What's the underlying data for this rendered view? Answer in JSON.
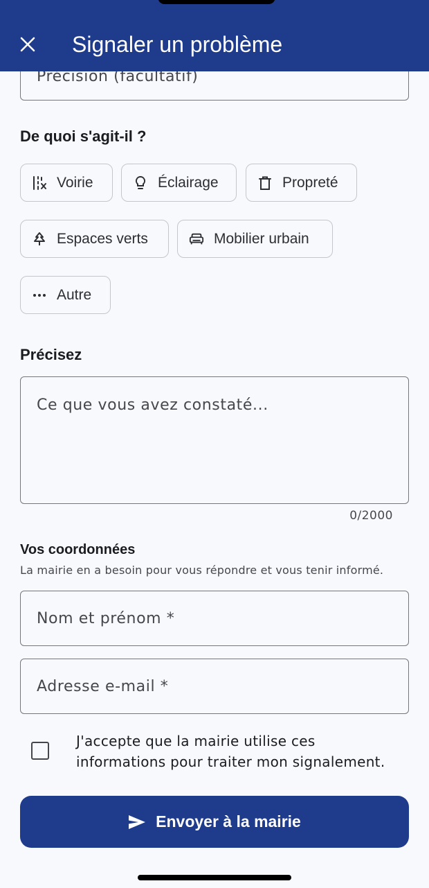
{
  "header": {
    "title": "Signaler un problème",
    "close_icon": "close-icon"
  },
  "precision_field": {
    "placeholder": "Précision (facultatif)"
  },
  "category": {
    "title": "De quoi s'agit-il ?",
    "chips": [
      {
        "label": "Voirie",
        "icon": "road-icon"
      },
      {
        "label": "Éclairage",
        "icon": "lightbulb-icon"
      },
      {
        "label": "Propreté",
        "icon": "trash-icon"
      },
      {
        "label": "Espaces verts",
        "icon": "tree-icon"
      },
      {
        "label": "Mobilier urbain",
        "icon": "bench-icon"
      },
      {
        "label": "Autre",
        "icon": "more-icon"
      }
    ]
  },
  "details": {
    "title": "Précisez",
    "placeholder": "Ce que vous avez constaté...",
    "counter": "0/2000"
  },
  "contact": {
    "title": "Vos coordonnées",
    "subtitle": "La mairie en a besoin pour vous répondre et vous tenir informé.",
    "name_placeholder": "Nom et prénom *",
    "email_placeholder": "Adresse e-mail *",
    "consent": "J'accepte que la mairie utilise ces informations pour traiter mon signalement.",
    "consent_checked": false
  },
  "submit": {
    "label": "Envoyer à la mairie",
    "icon": "send-icon"
  },
  "colors": {
    "primary": "#1f3b8c",
    "background": "#f8f9fc",
    "border": "#75767c"
  }
}
